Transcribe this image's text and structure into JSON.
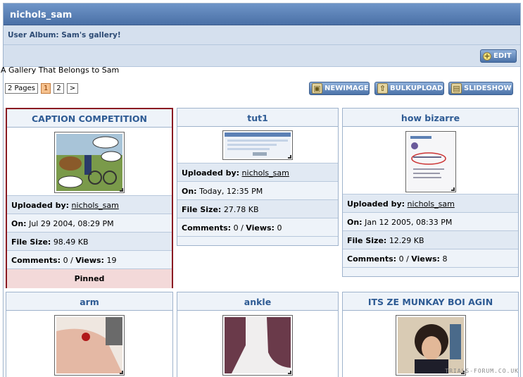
{
  "header": {
    "title": "nichols_sam",
    "subtitle": "User Album: Sam's gallery!"
  },
  "toolbar": {
    "edit_label": "EDIT"
  },
  "description": "A Gallery That Belongs to Sam",
  "pagination": {
    "summary": "2 Pages",
    "pages": [
      "1",
      "2"
    ],
    "current": "1",
    "next": ">"
  },
  "actions": {
    "new_image": "NEWIMAGE",
    "bulk_upload": "BULKUPLOAD",
    "slideshow": "SLIDESHOW"
  },
  "labels": {
    "uploaded_by": "Uploaded by:",
    "on": "On:",
    "file_size": "File Size:",
    "comments": "Comments:",
    "views": "Views:",
    "slash": "/",
    "pinned": "Pinned"
  },
  "images": [
    {
      "title": "CAPTION COMPETITION",
      "uploader": "nichols_sam",
      "date": "Jul 29 2004, 08:29 PM",
      "size": "98.49 KB",
      "comments": "0",
      "views": "19",
      "pinned": true
    },
    {
      "title": "tut1",
      "uploader": "nichols_sam",
      "date": "Today, 12:35 PM",
      "size": "27.78 KB",
      "comments": "0",
      "views": "0",
      "pinned": false
    },
    {
      "title": "how bizarre",
      "uploader": "nichols_sam",
      "date": "Jan 12 2005, 08:33 PM",
      "size": "12.29 KB",
      "comments": "0",
      "views": "8",
      "pinned": false
    },
    {
      "title": "arm"
    },
    {
      "title": "ankle"
    },
    {
      "title": "ITS ZE MUNKAY BOI AGIN"
    }
  ],
  "watermark": "TRIALS-FORUM.CO.UK",
  "colors": {
    "header": "#4a70a6",
    "accent": "#2e5b94",
    "pinned_border": "#8a1a22",
    "pinned_bg": "#f3d9d9"
  }
}
